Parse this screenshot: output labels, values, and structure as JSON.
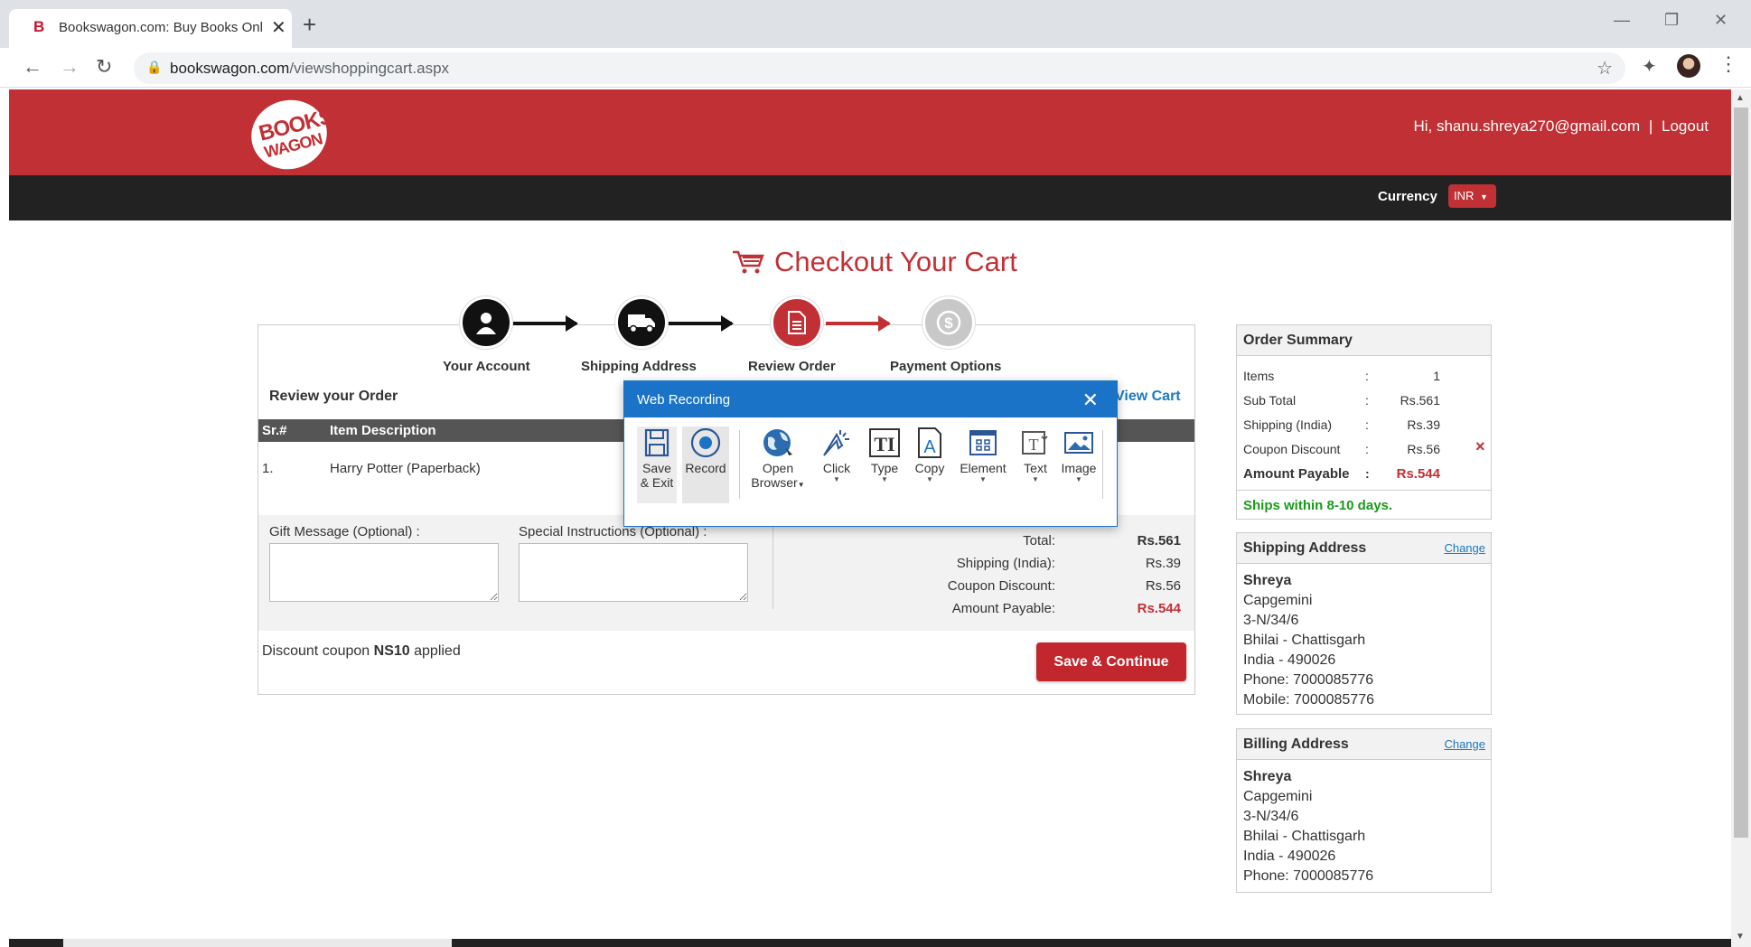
{
  "browser": {
    "tab_favicon": "B",
    "tab_title": "Bookswagon.com: Buy Books Online",
    "url_host": "bookswagon.com",
    "url_path": "/viewshoppingcart.aspx"
  },
  "header": {
    "logo_line1": "BOOKS",
    "logo_line2": "WAGON",
    "greeting": "Hi, shanu.shreya270@gmail.com",
    "separator": "|",
    "logout": "Logout",
    "currency_label": "Currency",
    "currency_value": "INR"
  },
  "page": {
    "title": "Checkout Your Cart"
  },
  "steps": [
    {
      "label": "Your Account",
      "state": "done"
    },
    {
      "label": "Shipping Address",
      "state": "done"
    },
    {
      "label": "Review Order",
      "state": "current"
    },
    {
      "label": "Payment Options",
      "state": "pending"
    }
  ],
  "review": {
    "title": "Review your Order",
    "view_cart": "View Cart",
    "col_sr": "Sr.#",
    "col_desc": "Item Description",
    "rows": [
      {
        "sr": "1.",
        "desc": "Harry Potter (Paperback)"
      }
    ],
    "gift_label": "Gift Message (Optional) :",
    "instructions_label": "Special Instructions (Optional) :",
    "totals": [
      {
        "label": "Total:",
        "value": "Rs.561",
        "bold": true
      },
      {
        "label": "Shipping (India):",
        "value": "Rs.39"
      },
      {
        "label": "Coupon Discount:",
        "value": "Rs.56"
      },
      {
        "label": "Amount Payable:",
        "value": "Rs.544",
        "red": true
      }
    ],
    "coupon_prefix": "Discount coupon",
    "coupon_code": "NS10",
    "coupon_suffix": "applied",
    "save_continue": "Save & Continue"
  },
  "summary": {
    "title": "Order Summary",
    "rows": [
      {
        "label": "Items",
        "value": "1"
      },
      {
        "label": "Sub Total",
        "value": "Rs.561"
      },
      {
        "label": "Shipping (India)",
        "value": "Rs.39"
      },
      {
        "label": "Coupon Discount",
        "value": "Rs.56"
      },
      {
        "label": "Amount Payable",
        "value": "Rs.544"
      }
    ],
    "colon": ":",
    "remove_coupon": "×",
    "ships_note": "Ships within 8-10 days."
  },
  "shipping": {
    "title": "Shipping Address",
    "change": "Change",
    "lines": [
      "Shreya",
      "Capgemini",
      "3-N/34/6",
      "Bhilai - Chattisgarh",
      "India - 490026",
      "Phone: 7000085776",
      "Mobile: 7000085776"
    ]
  },
  "billing": {
    "title": "Billing Address",
    "change": "Change",
    "lines": [
      "Shreya",
      "Capgemini",
      "3-N/34/6",
      "Bhilai - Chattisgarh",
      "India - 490026",
      "Phone: 7000085776"
    ]
  },
  "recorder": {
    "title": "Web Recording",
    "tools": [
      {
        "name": "save-exit",
        "line1": "Save",
        "line2": "& Exit"
      },
      {
        "name": "record",
        "line1": "Record",
        "line2": ""
      },
      {
        "name": "open-browser",
        "line1": "Open",
        "line2": "Browser"
      },
      {
        "name": "click",
        "line1": "Click",
        "line2": ""
      },
      {
        "name": "type",
        "line1": "Type",
        "line2": ""
      },
      {
        "name": "copy",
        "line1": "Copy",
        "line2": ""
      },
      {
        "name": "element",
        "line1": "Element",
        "line2": ""
      },
      {
        "name": "text",
        "line1": "Text",
        "line2": ""
      },
      {
        "name": "image",
        "line1": "Image",
        "line2": ""
      }
    ]
  },
  "colors": {
    "brand_red": "#c13034",
    "link_blue": "#1a7ac0",
    "recorder_blue": "#1a73c7",
    "success_green": "#1a9a1a"
  }
}
